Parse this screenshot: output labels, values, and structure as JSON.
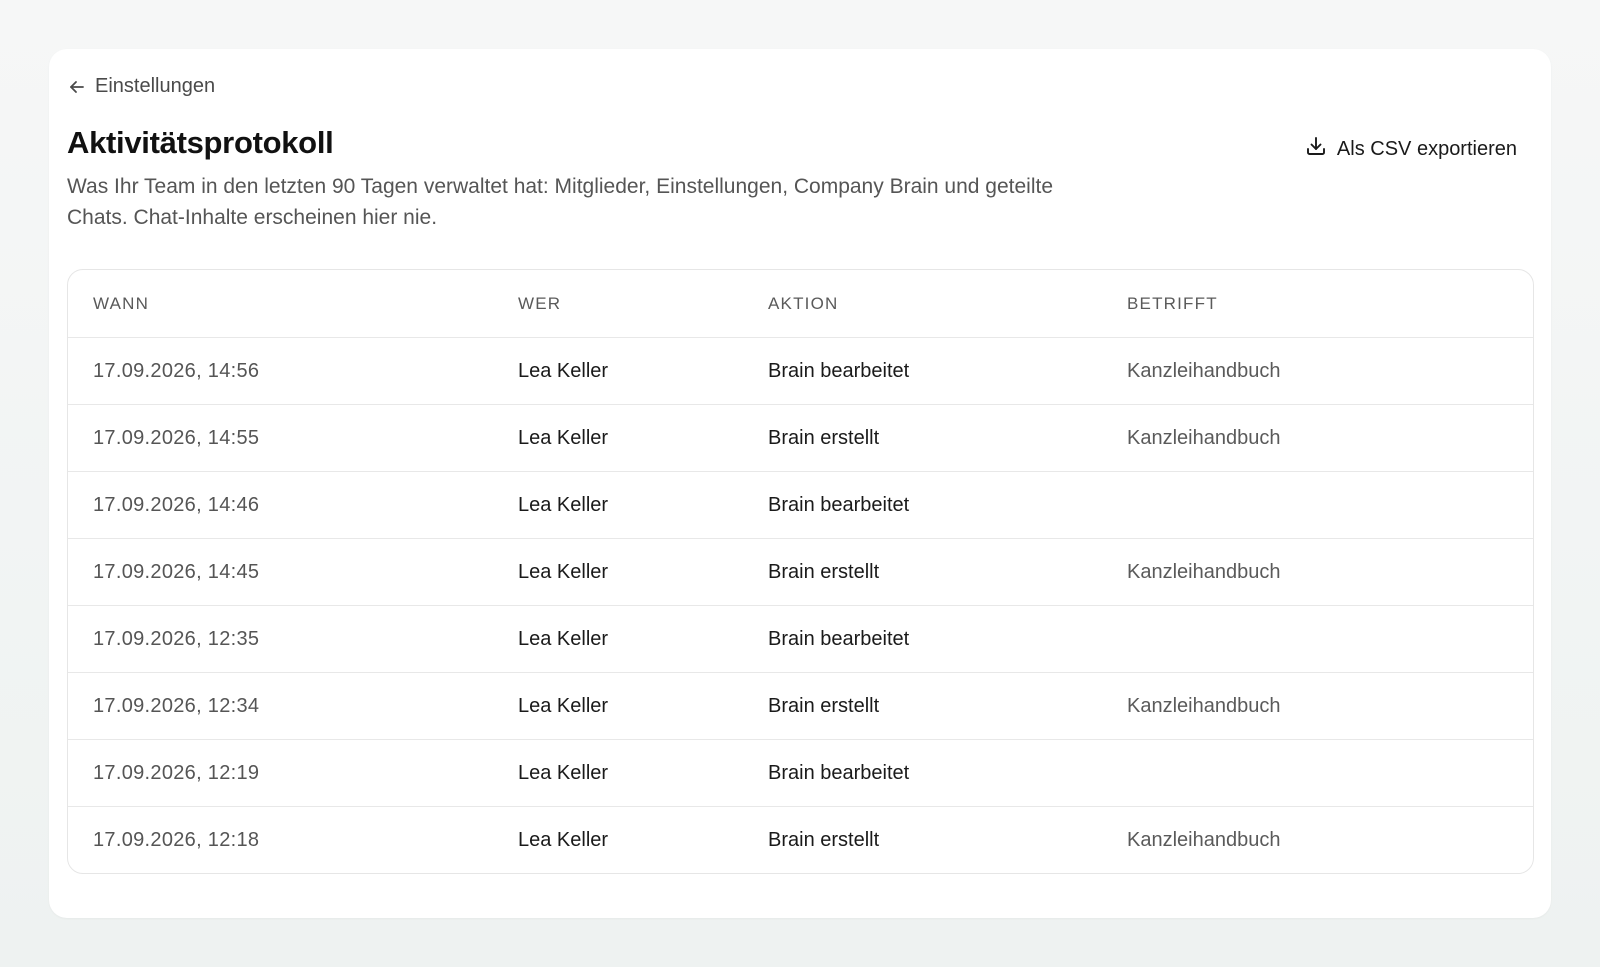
{
  "nav": {
    "back_label": "Einstellungen"
  },
  "header": {
    "title": "Aktivitätsprotokoll",
    "description": "Was Ihr Team in den letzten 90 Tagen verwaltet hat: Mitglieder, Einstellungen, Company Brain und geteilte Chats. Chat-Inhalte erscheinen hier nie.",
    "export_label": "Als CSV exportieren"
  },
  "icons": {
    "back": "arrow-left-icon",
    "export": "download-icon"
  },
  "table": {
    "columns": [
      "WANN",
      "WER",
      "AKTION",
      "BETRIFFT"
    ],
    "rows": [
      {
        "when": "17.09.2026, 14:56",
        "who": "Lea Keller",
        "action": "Brain bearbeitet",
        "target": "Kanzleihandbuch"
      },
      {
        "when": "17.09.2026, 14:55",
        "who": "Lea Keller",
        "action": "Brain erstellt",
        "target": "Kanzleihandbuch"
      },
      {
        "when": "17.09.2026, 14:46",
        "who": "Lea Keller",
        "action": "Brain bearbeitet",
        "target": ""
      },
      {
        "when": "17.09.2026, 14:45",
        "who": "Lea Keller",
        "action": "Brain erstellt",
        "target": "Kanzleihandbuch"
      },
      {
        "when": "17.09.2026, 12:35",
        "who": "Lea Keller",
        "action": "Brain bearbeitet",
        "target": ""
      },
      {
        "when": "17.09.2026, 12:34",
        "who": "Lea Keller",
        "action": "Brain erstellt",
        "target": "Kanzleihandbuch"
      },
      {
        "when": "17.09.2026, 12:19",
        "who": "Lea Keller",
        "action": "Brain bearbeitet",
        "target": ""
      },
      {
        "when": "17.09.2026, 12:18",
        "who": "Lea Keller",
        "action": "Brain erstellt",
        "target": "Kanzleihandbuch"
      }
    ]
  },
  "colors": {
    "background": "#eef2f1",
    "card": "#ffffff",
    "border": "#e6e6e6",
    "text": "#1a1a1a",
    "muted": "#555555"
  }
}
